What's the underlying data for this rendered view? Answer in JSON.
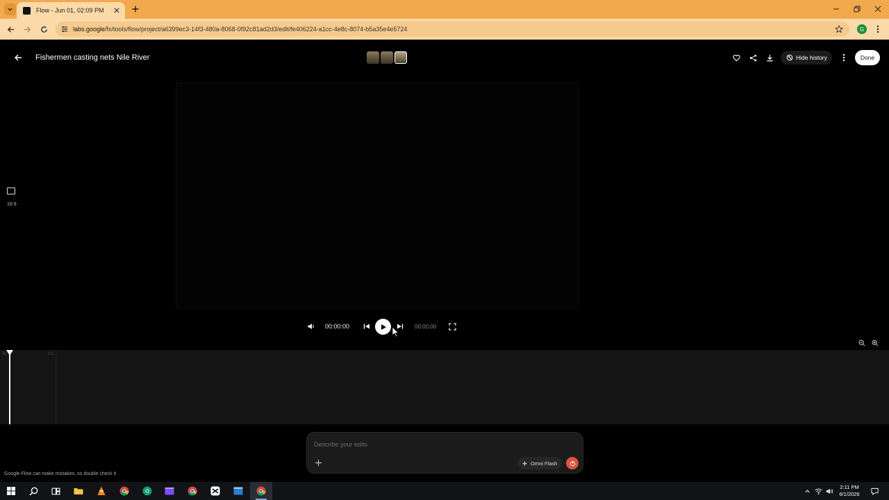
{
  "browser": {
    "tab_title": "Flow - Jun 01, 02:09 PM",
    "url_host": "labs.google",
    "url_path": "/fx/tools/flow/project/a6399ec3-14f3-480a-8068-0f92c81ad2d3/edit/fe406224-a1cc-4e8c-8074-b5a35e4e5724",
    "profile_initial": "G"
  },
  "header": {
    "title": "Fishermen casting nets Nile River",
    "hide_history_label": "Hide history",
    "done_label": "Done"
  },
  "aspect": {
    "label": "16:9"
  },
  "player": {
    "current_time": "00:00:00",
    "duration": "00:00:00"
  },
  "timeline": {
    "tick_start": "00",
    "tick_next": "0:1"
  },
  "prompt": {
    "placeholder": "Describe your edits",
    "model_label": "Omni Flash"
  },
  "disclaimer": "Google Flow can make mistakes, so double check it",
  "taskbar": {
    "time": "2:11 PM",
    "date": "6/1/2026"
  },
  "colors": {
    "tab_strip": "#f2a94e",
    "toolbar": "#fbd9a8",
    "send_button": "#d9543f"
  }
}
